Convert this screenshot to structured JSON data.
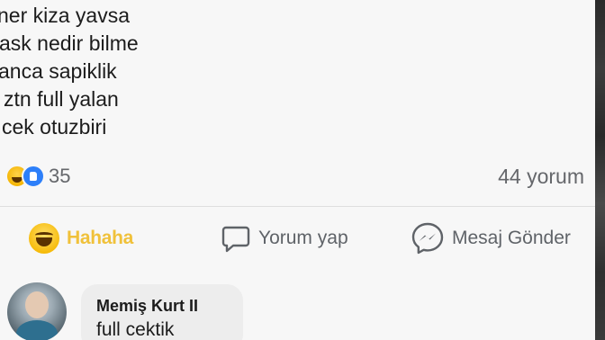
{
  "post": {
    "lines": [
      "ner kiza yavsa",
      "ask nedir bilme",
      "anca sapiklik",
      "ztn full yalan",
      "cek otuzbiri"
    ]
  },
  "reactions": {
    "icons": [
      "haha-reaction-icon",
      "like-reaction-icon"
    ],
    "count": "35"
  },
  "comments_count": "44 yorum",
  "actions": {
    "haha_label": "Hahaha",
    "comment_label": "Yorum yap",
    "message_label": "Mesaj Gönder"
  },
  "comment": {
    "author": "Memiş Kurt II",
    "text": "full cektik"
  },
  "colors": {
    "card_background": "#f7f7f7",
    "text_primary": "#1c1c1c",
    "text_secondary": "#65676b",
    "haha_yellow": "#f0c13a",
    "like_blue": "#2d7ff9"
  }
}
